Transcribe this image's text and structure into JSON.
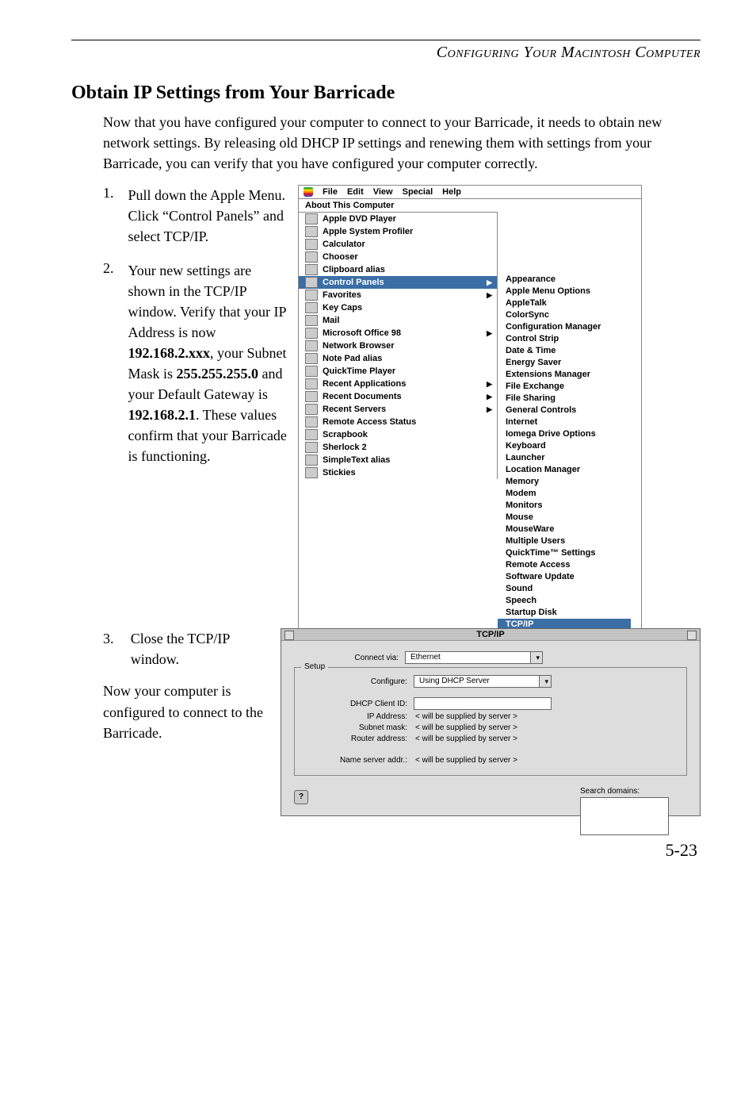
{
  "running_head": "Configuring Your Macintosh Computer",
  "section_title": "Obtain IP Settings from Your Barricade",
  "intro": "Now that you have configured your computer to connect to your Barricade, it needs to obtain new network settings. By releasing old DHCP IP settings and renewing them with settings from your Barricade, you can verify that you have configured your computer correctly.",
  "steps": {
    "s1": {
      "num": "1.",
      "text": "Pull down the Apple Menu. Click “Control Panels” and select TCP/IP."
    },
    "s2": {
      "num": "2.",
      "pre": "Your new settings are shown in the TCP/IP window. Verify that your IP Address is now ",
      "b1": "192.168.2.xxx",
      "mid1": ", your Subnet Mask is ",
      "b2": "255.255.255.0",
      "mid2": " and your Default Gateway is ",
      "b3": "192.168.2.1",
      "post": ". These values confirm that your Barricade is functioning."
    },
    "s3": {
      "num": "3.",
      "text": "Close the TCP/IP window."
    }
  },
  "conclusion": "Now your computer is configured to connect to the Barricade.",
  "page_number": "5-23",
  "mac_menu": {
    "bar": {
      "file": "File",
      "edit": "Edit",
      "view": "View",
      "special": "Special",
      "help": "Help"
    },
    "about": "About This Computer",
    "items": [
      "Apple DVD Player",
      "Apple System Profiler",
      "Calculator",
      "Chooser",
      "Clipboard alias",
      "Control Panels",
      "Favorites",
      "Key Caps",
      "Mail",
      "Microsoft Office 98",
      "Network Browser",
      "Note Pad alias",
      "QuickTime Player",
      "Recent Applications",
      "Recent Documents",
      "Recent Servers",
      "Remote Access Status",
      "Scrapbook",
      "Sherlock 2",
      "SimpleText alias",
      "Stickies"
    ],
    "arrow_indices": [
      5,
      6,
      9,
      13,
      14,
      15
    ],
    "selected_index": 5
  },
  "control_panels": {
    "items": [
      "Appearance",
      "Apple Menu Options",
      "AppleTalk",
      "ColorSync",
      "Configuration Manager",
      "Control Strip",
      "Date & Time",
      "Energy Saver",
      "Extensions Manager",
      "File Exchange",
      "File Sharing",
      "General Controls",
      "Internet",
      "Iomega Drive Options",
      "Keyboard",
      "Launcher",
      "Location Manager",
      "Memory",
      "Modem",
      "Monitors",
      "Mouse",
      "MouseWare",
      "Multiple Users",
      "QuickTime™ Settings",
      "Remote Access",
      "Software Update",
      "Sound",
      "Speech",
      "Startup Disk",
      "TCP/IP"
    ],
    "selected_index": 29
  },
  "tcpip": {
    "title": "TCP/IP",
    "connect_via_label": "Connect via:",
    "connect_via_value": "Ethernet",
    "setup_legend": "Setup",
    "configure_label": "Configure:",
    "configure_value": "Using DHCP Server",
    "dhcp_client_label": "DHCP Client ID:",
    "dhcp_client_value": "",
    "ip_label": "IP Address:",
    "subnet_label": "Subnet mask:",
    "router_label": "Router address:",
    "ns_label": "Name server addr.:",
    "supplied": "< will be supplied by server >",
    "search_label": "Search domains:",
    "info_btn": "?"
  }
}
